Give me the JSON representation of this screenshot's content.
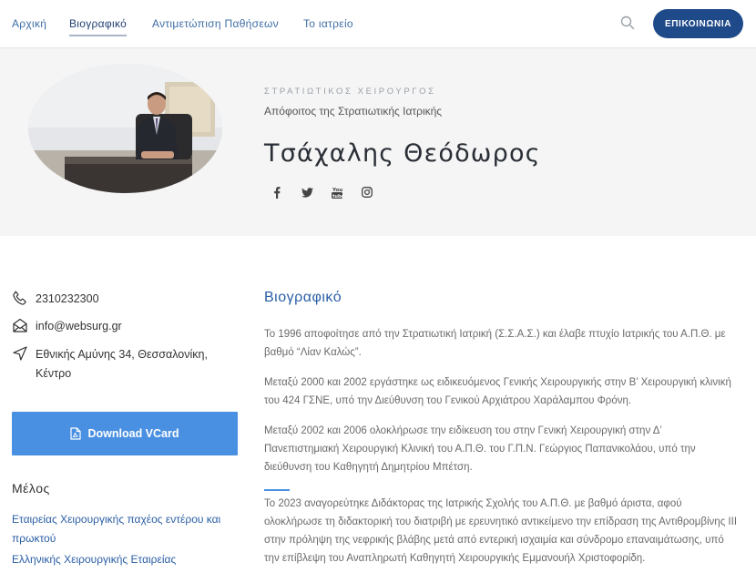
{
  "nav": {
    "items": [
      {
        "label": "Αρχική",
        "active": false
      },
      {
        "label": "Βιογραφικό",
        "active": true
      },
      {
        "label": "Αντιμετώπιση Παθήσεων",
        "active": false
      },
      {
        "label": "Το ιατρείο",
        "active": false
      }
    ],
    "search_icon": "search-icon",
    "contact_label": "ΕΠΙΚΟΙΝΩΝΙΑ",
    "accent_color": "#1f4a8a"
  },
  "hero": {
    "kicker": "ΣΤΡΑΤΙΩΤΙΚΟΣ ΧΕΙΡΟΥΡΓΟΣ",
    "subtitle": "Απόφοιτος της Στρατιωτικής Ιατρικής",
    "name": "Τσάχαλης Θεόδωρος",
    "socials": [
      "facebook-icon",
      "twitter-icon",
      "youtube-icon",
      "instagram-icon"
    ]
  },
  "contact": {
    "phone": "2310232300",
    "email": "info@websurg.gr",
    "address_line1": "Εθνικής Αμύνης 34, Θεσσαλονίκη,",
    "address_line2": "Κέντρο"
  },
  "vcard": {
    "label": "Download VCard",
    "color": "#4a90e2"
  },
  "membership": {
    "title": "Μέλος",
    "items": [
      "Εταιρείας Χειρουργικής παχέος εντέρου και πρωκτού",
      "Ελληνικής Χειρουργικής Εταιρείας"
    ]
  },
  "bio": {
    "title": "Βιογραφικό",
    "paragraphs": [
      "Το 1996 αποφοίτησε από την Στρατιωτική Ιατρική (Σ.Σ.Α.Σ.) και έλαβε πτυχίο Ιατρικής του Α.Π.Θ. με βαθμό “Λίαν Καλώς”.",
      "Μεταξύ 2000 και 2002 εργάστηκε ως ειδικευόμενος Γενικής Χειρουργικής στην Β’ Χειρουργική κλινική του 424 ΓΣΝΕ, υπό την Διεύθυνση του Γενικού Αρχιάτρου Χαράλαμπου Φρόνη.",
      "Μεταξύ 2002 και 2006 ολοκλήρωσε την ειδίκευση του στην Γενική Χειρουργική στην Δ’ Πανεπιστημιακή Χειρουργική Κλινική του Α.Π.Θ. του Γ.Π.Ν. Γεώργιος Παπανικολάου, υπό την διεύθυνση του Καθηγητή Δημητρίου Μπέτση.",
      "Το 2023 αναγορεύτηκε Διδάκτορας της Ιατρικής Σχολής του Α.Π.Θ. με βαθμό άριστα, αφού ολοκλήρωσε τη διδακτορική του διατριβή με ερευνητικό αντικείμενο την επίδραση της Αντιθρομβίνης III στην πρόληψη της νεφρικής βλάβης μετά από εντερική ισχαιμία και σύνδρομο επαναιμάτωσης, υπό την επίβλεψη του Αναπληρωτή Καθηγητή Χειρουργικής Εμμανουήλ Χριστοφορίδη."
    ]
  }
}
